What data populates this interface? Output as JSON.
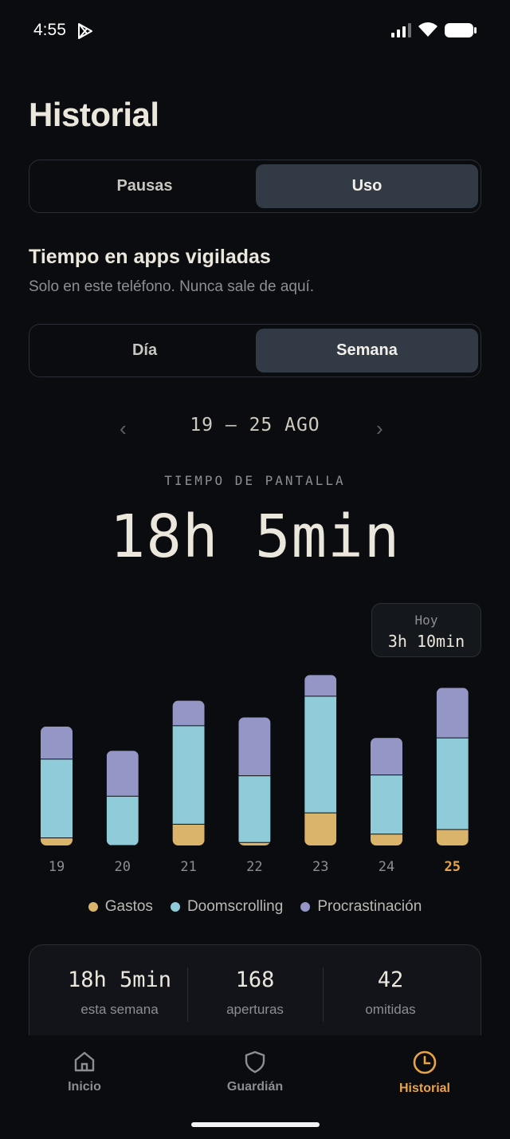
{
  "status": {
    "time": "4:55"
  },
  "page": {
    "title": "Historial"
  },
  "top_tabs": [
    {
      "label": "Pausas",
      "active": false
    },
    {
      "label": "Uso",
      "active": true
    }
  ],
  "section": {
    "title": "Tiempo en apps vigiladas",
    "subtitle": "Solo en este teléfono. Nunca sale de aquí."
  },
  "period_tabs": [
    {
      "label": "Día",
      "active": false
    },
    {
      "label": "Semana",
      "active": true
    }
  ],
  "range": {
    "prev_icon": "‹",
    "label": "19 – 25 AGO",
    "next_icon": "›"
  },
  "screen_time": {
    "kicker": "TIEMPO DE PANTALLA",
    "total": "18h 5min"
  },
  "tooltip": {
    "label": "Hoy",
    "value": "3h 10min"
  },
  "colors": {
    "gastos": "#d9b46a",
    "doomscrolling": "#8fcbd8",
    "procrastinacion": "#9497c6",
    "accent": "#e8a34a"
  },
  "chart_data": {
    "type": "bar",
    "stacked": true,
    "categories": [
      "19",
      "20",
      "21",
      "22",
      "23",
      "24",
      "25"
    ],
    "highlight_category": "25",
    "series": [
      {
        "name": "Gastos",
        "values": [
          10,
          0,
          28,
          4,
          43,
          15,
          21
        ]
      },
      {
        "name": "Doomscrolling",
        "values": [
          104,
          65,
          130,
          88,
          154,
          78,
          121
        ]
      },
      {
        "name": "Procrastinación",
        "values": [
          43,
          60,
          33,
          77,
          28,
          49,
          66
        ]
      }
    ],
    "unit": "min"
  },
  "legend": [
    {
      "label": "Gastos",
      "color": "#d9b46a"
    },
    {
      "label": "Doomscrolling",
      "color": "#8fcbd8"
    },
    {
      "label": "Procrastinación",
      "color": "#9497c6"
    }
  ],
  "stats": [
    {
      "value": "18h 5min",
      "label": "esta semana"
    },
    {
      "value": "168",
      "label": "aperturas"
    },
    {
      "value": "42",
      "label": "omitidas"
    }
  ],
  "nav": [
    {
      "label": "Inicio",
      "icon": "home-icon",
      "active": false
    },
    {
      "label": "Guardián",
      "icon": "shield-icon",
      "active": false
    },
    {
      "label": "Historial",
      "icon": "clock-icon",
      "active": true
    }
  ]
}
